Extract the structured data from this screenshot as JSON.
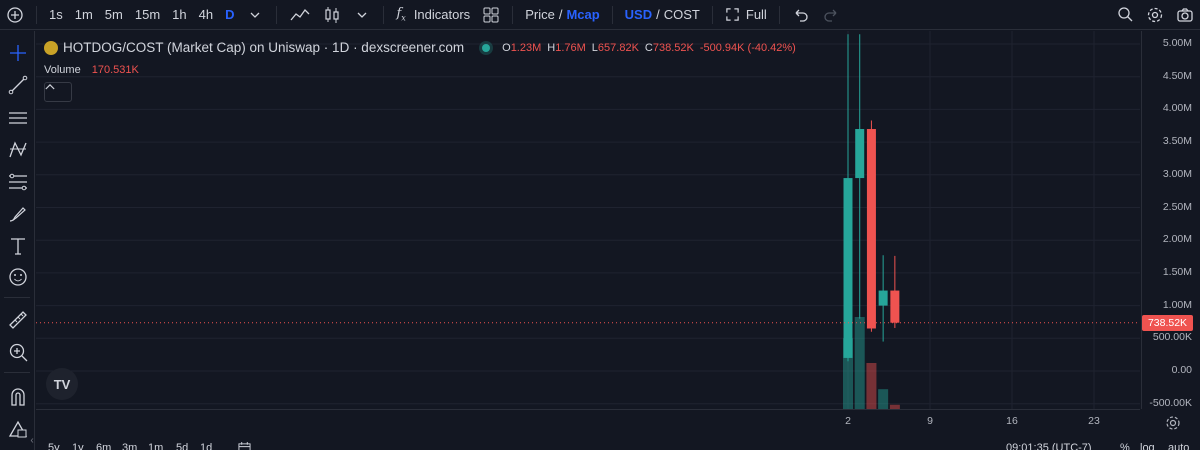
{
  "toolbar": {
    "intervals": [
      "1s",
      "1m",
      "5m",
      "15m",
      "1h",
      "4h",
      "D"
    ],
    "active_interval": "D",
    "indicators_label": "Indicators",
    "price_label": "Price",
    "separator": "/",
    "mcap_label": "Mcap",
    "usd_label": "USD",
    "cost_label": "COST",
    "full_label": "Full",
    "colors": {
      "accent": "#2962ff",
      "text": "#d1d4dc",
      "background": "#131722"
    }
  },
  "legend": {
    "title": "HOTDOG/COST (Market Cap) on Uniswap · 1D · dexscreener.com",
    "open_label": "O",
    "open_value": "1.23M",
    "high_label": "H",
    "high_value": "1.76M",
    "low_label": "L",
    "low_value": "657.82K",
    "close_label": "C",
    "close_value": "738.52K",
    "change": "-500.94K (-40.42%)",
    "volume_label": "Volume",
    "volume_value": "170.531K",
    "toggle_icon": "chevron-up-icon"
  },
  "logo_text": "TV",
  "price_axis": {
    "labels": [
      "5.00M",
      "4.50M",
      "4.00M",
      "3.50M",
      "3.00M",
      "2.50M",
      "2.00M",
      "1.50M",
      "1.00M",
      "500.00K",
      "0.00",
      "-500.00K"
    ],
    "current_price": "738.52K"
  },
  "time_axis": {
    "labels": [
      "2",
      "9",
      "16",
      "23"
    ]
  },
  "bottom_bar": {
    "ranges": [
      "5y",
      "1y",
      "6m",
      "3m",
      "1m",
      "5d",
      "1d"
    ],
    "clock": "09:01:35 (UTC-7)",
    "pct_label": "%",
    "log_label": "log",
    "auto_label": "auto"
  },
  "chart_data": {
    "type": "candlestick",
    "title": "HOTDOG/COST (Market Cap) on Uniswap · 1D · dexscreener.com",
    "x_unit": "day",
    "ylim": [
      -600000,
      5150000
    ],
    "candles": [
      {
        "x": 2,
        "open": 200000,
        "high": 5150000,
        "low": 150000,
        "close": 2950000
      },
      {
        "x": 3,
        "open": 2950000,
        "high": 5150000,
        "low": 800000,
        "close": 3700000
      },
      {
        "x": 4,
        "open": 3700000,
        "high": 3830000,
        "low": 600000,
        "close": 650000
      },
      {
        "x": 5,
        "open": 1000000,
        "high": 1770000,
        "low": 450000,
        "close": 1230000
      },
      {
        "x": 6,
        "open": 1230000,
        "high": 1760000,
        "low": 657820,
        "close": 738520
      }
    ],
    "volume": [
      {
        "x": 2,
        "value": 1,
        "direction": "up"
      },
      {
        "x": 3,
        "value": 1.3,
        "direction": "up"
      },
      {
        "x": 4,
        "value": 0.65,
        "direction": "down"
      },
      {
        "x": 5,
        "value": 0.28,
        "direction": "up"
      },
      {
        "x": 6,
        "value": 0.06,
        "direction": "down"
      }
    ],
    "current_price": 738520,
    "colors": {
      "up": "#26a69a",
      "down": "#ef5350",
      "grid": "#1f2330",
      "price_line": "#ef5350"
    }
  }
}
